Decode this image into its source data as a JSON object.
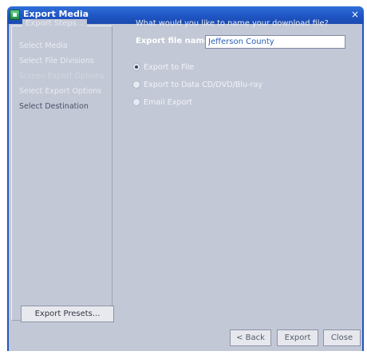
{
  "window": {
    "title": "Export Media",
    "close_glyph": "×"
  },
  "steps": {
    "legend": "Export Steps...",
    "items": [
      {
        "label": "Select Media",
        "state": "done"
      },
      {
        "label": "Select File Divisions",
        "state": "done"
      },
      {
        "label": "Screen Export Options",
        "state": "skipped"
      },
      {
        "label": "Select Export Options",
        "state": "done"
      },
      {
        "label": "Select Destination",
        "state": "active"
      }
    ]
  },
  "presets_button": "Export Presets...",
  "question": "What would you like to name your download file?",
  "export_name": {
    "label": "Export file name:",
    "value": "Jefferson County"
  },
  "destinations": [
    {
      "label": "Export to File",
      "selected": true
    },
    {
      "label": "Export to Data CD/DVD/Blu-ray",
      "selected": false
    },
    {
      "label": "Email Export",
      "selected": false
    }
  ],
  "footer": {
    "back": "< Back",
    "export": "Export",
    "close": "Close"
  },
  "colors": {
    "titlebar": "#1f55c4",
    "panel": "#c3c8d6"
  }
}
